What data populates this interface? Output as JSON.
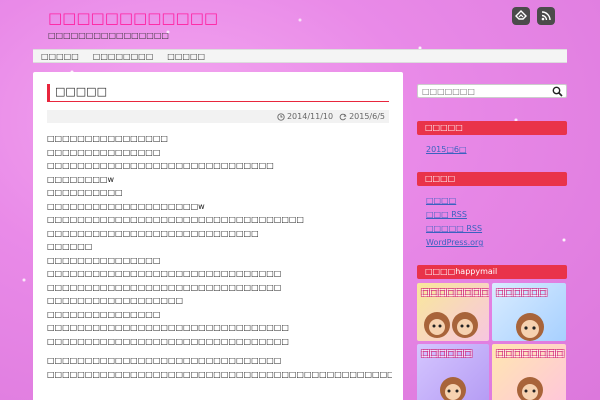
{
  "site": {
    "title": "□□□□□□□□□□□□",
    "tagline": "□□□□□□□□□□□□□□□□"
  },
  "header_icons": [
    {
      "name": "feedly-icon"
    },
    {
      "name": "rss-icon"
    }
  ],
  "nav": {
    "items": [
      {
        "label": "□□□□□"
      },
      {
        "label": "□□□□□□□□"
      },
      {
        "label": "□□□□□"
      }
    ]
  },
  "post": {
    "title": "□□□□□",
    "published": "2014/11/10",
    "modified": "2015/6/5",
    "lines": [
      "□□□□□□□□□□□□□□□□",
      "□□□□□□□□□□□□□□□",
      "□□□□□□□□□□□□□□□□□□□□□□□□□□□□□□",
      "□□□□□□□□w",
      "□□□□□□□□□□",
      "□□□□□□□□□□□□□□□□□□□□w",
      "□□□□□□□□□□□□□□□□□□□□□□□□□□□□□□□□□□",
      "□□□□□□□□□□□□□□□□□□□□□□□□□□□□",
      "□□□□□□",
      "□□□□□□□□□□□□□□□",
      "□□□□□□□□□□□□□□□□□□□□□□□□□□□□□□□",
      "□□□□□□□□□□□□□□□□□□□□□□□□□□□□□□□",
      "□□□□□□□□□□□□□□□□□□",
      "□□□□□□□□□□□□□□□",
      "□□□□□□□□□□□□□□□□□□□□□□□□□□□□□□□□",
      "□□□□□□□□□□□□□□□□□□□□□□□□□□□□□□□□"
    ],
    "lines2": [
      "□□□□□□□□□□□□□□□□□□□□□□□□□□□□□□□",
      "□□□□□□□□□□□□□□□□□□□□□□□□□□□□□□□□□□□□□□□□□□□□□□□□□□□□□□□□"
    ]
  },
  "sidebar": {
    "search_placeholder": "□□□□□□□",
    "archive": {
      "heading": "□□□□□",
      "links": [
        "2015□6□"
      ]
    },
    "meta": {
      "heading": "□□□□",
      "links": [
        "□□□□",
        "□□□ RSS",
        "□□□□□ RSS",
        "WordPress.org"
      ]
    },
    "happymail": {
      "heading": "□□□□happymail",
      "banners": [
        {
          "text": "□□□□□□□□□□□"
        },
        {
          "text": "□□□□□□"
        },
        {
          "text": "□□□□□□"
        },
        {
          "text": "□□□□□□□□"
        }
      ]
    }
  },
  "colors": {
    "accent": "#e9334a",
    "title": "#ff1fa0",
    "link": "#3a62c0",
    "background": "#e98ae8"
  }
}
